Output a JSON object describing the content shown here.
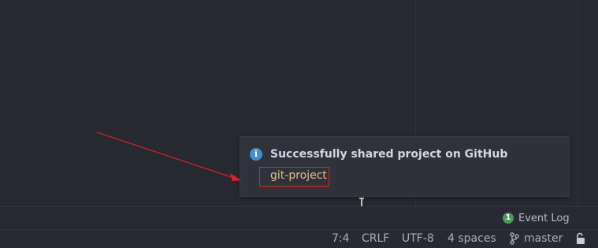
{
  "notification": {
    "title": "Successfully shared project on GitHub",
    "link": "git-project",
    "icon": "info-icon",
    "icon_color": "#3d8fd6"
  },
  "event_log": {
    "badge_count": "1",
    "label": "Event Log",
    "badge_color": "#3f9f4f"
  },
  "status_bar": {
    "caret_position": "7:4",
    "line_separator": "CRLF",
    "encoding": "UTF-8",
    "indent": "4 spaces",
    "branch": "master",
    "branch_icon": "git-branch-icon",
    "lock_icon": "lock-icon"
  },
  "annotation": {
    "color": "#e32020"
  }
}
